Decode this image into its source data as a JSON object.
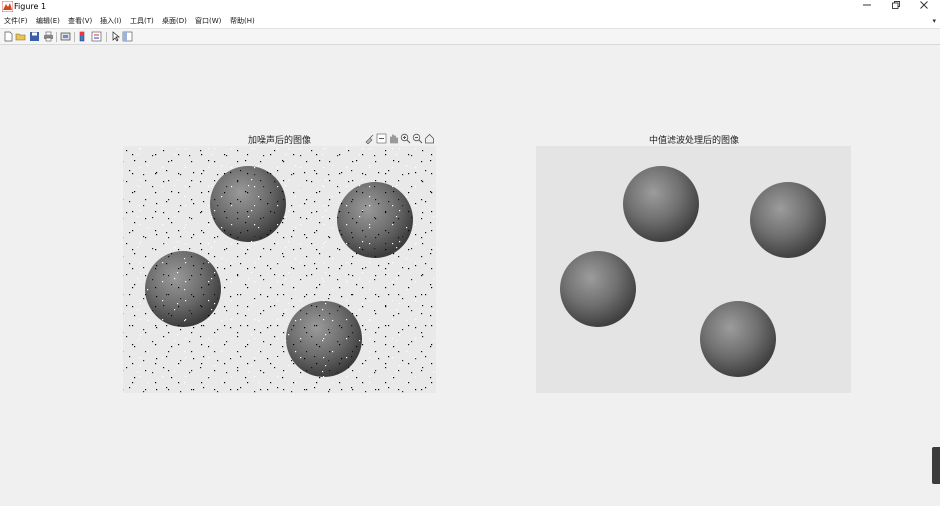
{
  "window": {
    "title": "Figure 1",
    "controls": [
      "minimize",
      "restore",
      "close"
    ]
  },
  "menubar": {
    "items": [
      {
        "label": "文件(F)"
      },
      {
        "label": "编辑(E)"
      },
      {
        "label": "查看(V)"
      },
      {
        "label": "插入(I)"
      },
      {
        "label": "工具(T)"
      },
      {
        "label": "桌面(D)"
      },
      {
        "label": "窗口(W)"
      },
      {
        "label": "帮助(H)"
      }
    ]
  },
  "toolbar": {
    "buttons": [
      "new-figure-icon",
      "open-file-icon",
      "save-icon",
      "print-icon",
      "link-plot-icon",
      "colorbar-icon",
      "legend-icon",
      "edit-plot-icon",
      "property-inspector-icon"
    ]
  },
  "axes_left": {
    "title": "加噪声后的图像",
    "tools": [
      "brush-icon",
      "datatip-icon",
      "pan-icon",
      "zoom-in-icon",
      "zoom-out-icon",
      "home-icon"
    ]
  },
  "axes_right": {
    "title": "中值滤波处理后的图像"
  },
  "colors": {
    "figure_bg": "#f0f0f0",
    "titlebar_bg": "#ffffff",
    "image_bg": "#e6e6e6",
    "coin": "#6e6e6e"
  }
}
